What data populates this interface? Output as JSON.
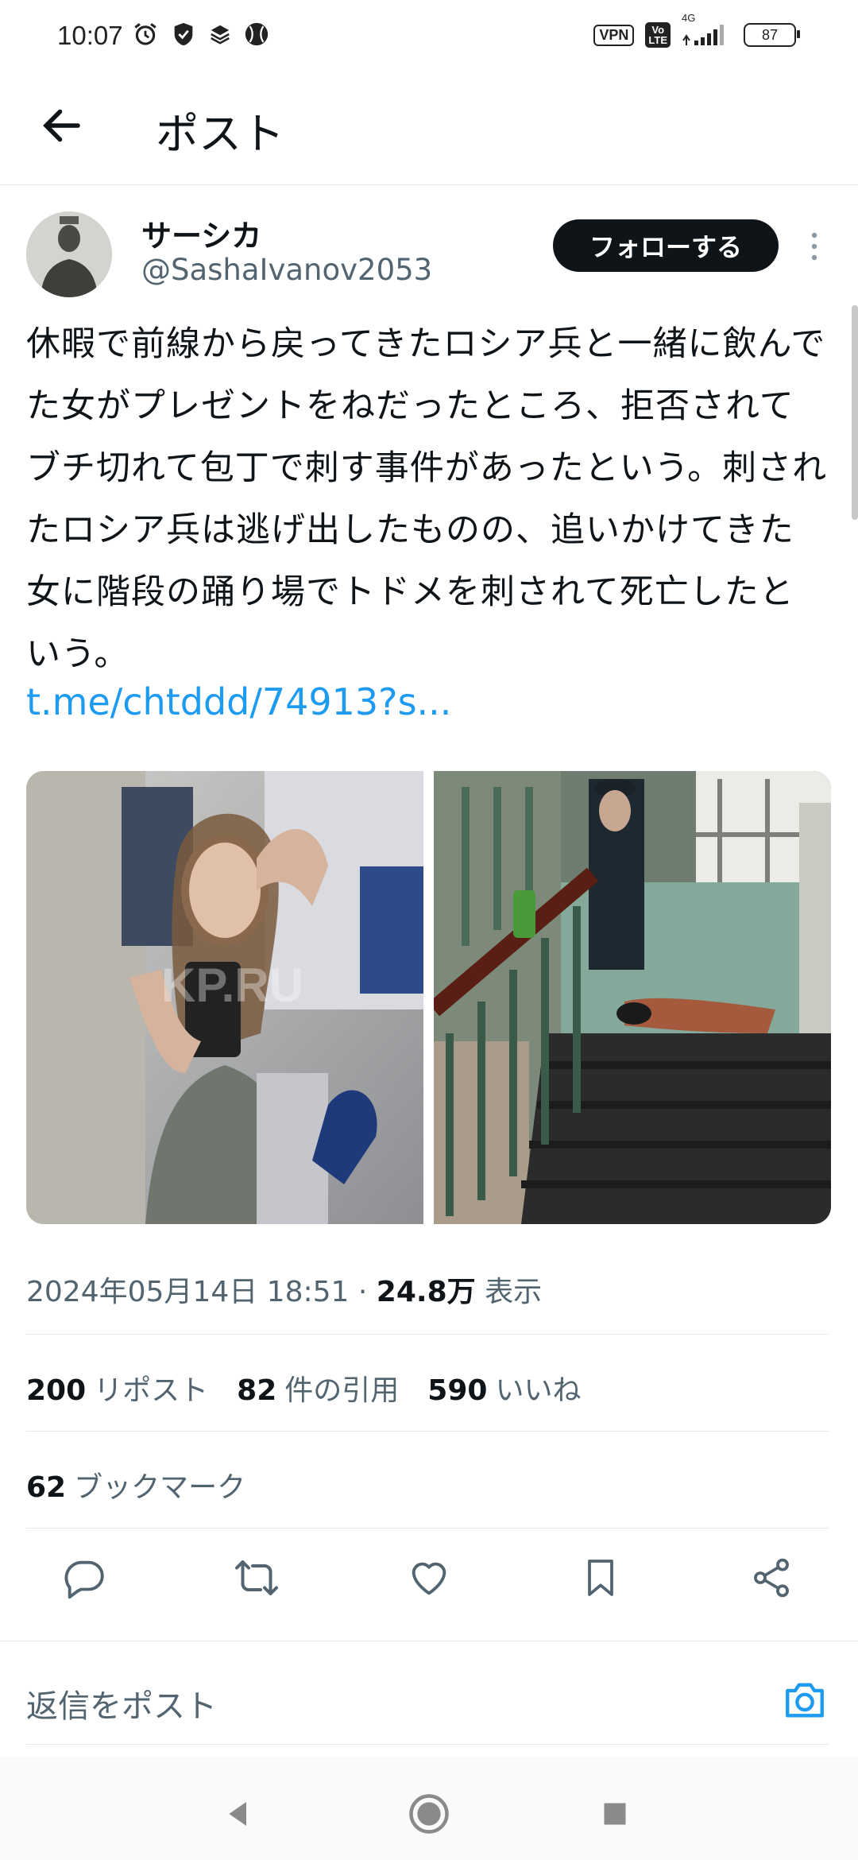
{
  "status_bar": {
    "time": "10:07",
    "vpn": "VPN",
    "volte_top": "Vo",
    "volte_bottom": "LTE",
    "network": "4G",
    "battery": "87"
  },
  "header": {
    "title": "ポスト"
  },
  "author": {
    "display_name": "サーシカ",
    "handle": "@SashaIvanov2053",
    "follow_label": "フォローする"
  },
  "tweet": {
    "text": "休暇で前線から戻ってきたロシア兵と一緒に飲んでた女がプレゼントをねだったところ、拒否されてブチ切れて包丁で刺す事件があったという。刺されたロシア兵は逃げ出したものの、追いかけてきた女に階段の踊り場でトドメを刺されて死亡したという。",
    "link": "t.me/chtddd/74913?s...",
    "watermark": "KP.RU"
  },
  "meta": {
    "datetime": "2024年05月14日 18:51",
    "separator": "·",
    "views": "24.8万",
    "views_label": "表示"
  },
  "stats": {
    "reposts": "200",
    "reposts_label": "リポスト",
    "quotes": "82",
    "quotes_label": "件の引用",
    "likes": "590",
    "likes_label": "いいね",
    "bookmarks": "62",
    "bookmarks_label": "ブックマーク"
  },
  "actions": {
    "icons": [
      "reply-icon",
      "repost-icon",
      "like-icon",
      "bookmark-icon",
      "share-icon"
    ]
  },
  "reply": {
    "placeholder": "返信をポスト"
  },
  "colors": {
    "link": "#1d9bf0",
    "text": "#0f1419",
    "muted": "#536471",
    "follow_bg": "#0f1419",
    "divider": "#e6e8eb"
  }
}
